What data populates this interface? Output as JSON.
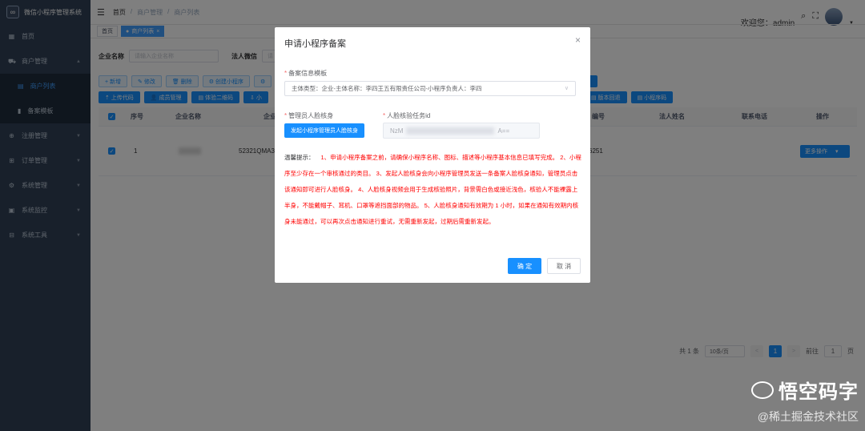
{
  "app": {
    "title": "微信小程序管理系统",
    "logo_glyph": "∞"
  },
  "sidebar": {
    "items": [
      {
        "label": "首页",
        "icon": "dashboard-icon",
        "glyph": "▦"
      },
      {
        "label": "商户管理",
        "icon": "shop-icon",
        "glyph": "⛟"
      },
      {
        "label": "注册管理",
        "icon": "register-icon",
        "glyph": "⊕"
      },
      {
        "label": "订单管理",
        "icon": "cart-icon",
        "glyph": "⊞"
      },
      {
        "label": "系统管理",
        "icon": "gear-icon",
        "glyph": "⚙"
      },
      {
        "label": "系统监控",
        "icon": "monitor-icon",
        "glyph": "▣"
      },
      {
        "label": "系统工具",
        "icon": "tool-icon",
        "glyph": "⊟"
      }
    ],
    "sub_items": [
      {
        "label": "商户列表",
        "glyph": "▤"
      },
      {
        "label": "备案模板",
        "glyph": "▮"
      }
    ]
  },
  "header": {
    "breadcrumb": [
      "首页",
      "/",
      "商户管理",
      "/",
      "商户列表"
    ],
    "welcome": "欢迎您：admin"
  },
  "tags": {
    "home": "首页",
    "current": "商户列表"
  },
  "search": {
    "company_label": "企业名称",
    "company_placeholder": "请输入企业名称",
    "legal_label": "法人微信",
    "legal_placeholder": "请"
  },
  "toolbar": {
    "row1": [
      "+ 新增",
      "✎ 修改",
      "🗑 删除",
      "⚙ 创建小程序",
      "⚙"
    ],
    "row1_right": [
      ""
    ],
    "row2": [
      "⇡ 上传代码",
      "👤 成员管理",
      "▤ 体验二维码",
      "⇩ 小"
    ],
    "row2_right": [
      "▤ 版本回退",
      "▤ 小程序码"
    ]
  },
  "table": {
    "headers": [
      "序号",
      "企业名称",
      "企业",
      "编号",
      "法人姓名",
      "联系电话",
      "操作"
    ],
    "row": {
      "index": "1",
      "credit": "52321QMA3",
      "phone_suffix": "6251",
      "action": "更多操作",
      "check": "✓"
    }
  },
  "pager": {
    "total": "共 1 条",
    "size": "10条/页",
    "page": "1",
    "goto_label": "前往",
    "goto_value": "1",
    "page_unit": "页",
    "prev": "<",
    "next": ">"
  },
  "dialog": {
    "title": "申请小程序备案",
    "close": "×",
    "template_label": "备案信息模板",
    "template_value": "主体类型：企业-主体名称：李四王五有限责任公司-小程序负责人：李四",
    "face_label": "管理员人脸核身",
    "face_button": "发起小程序管理员人脸核身",
    "taskid_label": "人脸核验任务id",
    "taskid_prefix": "NzM",
    "taskid_suffix": "A==",
    "tips_label": "温馨提示：",
    "tips_text": "1、申请小程序备案之前，请确保小程序名称、图标、描述等小程序基本信息已填写完成。 2、小程序至少存在一个审核通过的类目。 3、发起人脸核身会向小程序管理员发送一条备案人脸核身通知，管理员点击该通知即可进行人脸核身。 4、人脸核身视频会用于生成核验照片，背景需白色或接近浅色，核验人不能裸露上半身，不能戴帽子、耳机、口罩等遮挡面部的物品。 5、人脸核身通知有效期为 1 小时，如果在通知有效期内核身未能通过，可以再次点击通知进行重试，无需重新发起，过期后需重新发起。",
    "ok": "确 定",
    "cancel": "取 消"
  },
  "watermark": {
    "brand": "悟空码字",
    "sub": "@稀土掘金技术社区"
  },
  "colors": {
    "sidebar": "#304156",
    "primary": "#1890ff",
    "danger": "#f00"
  }
}
